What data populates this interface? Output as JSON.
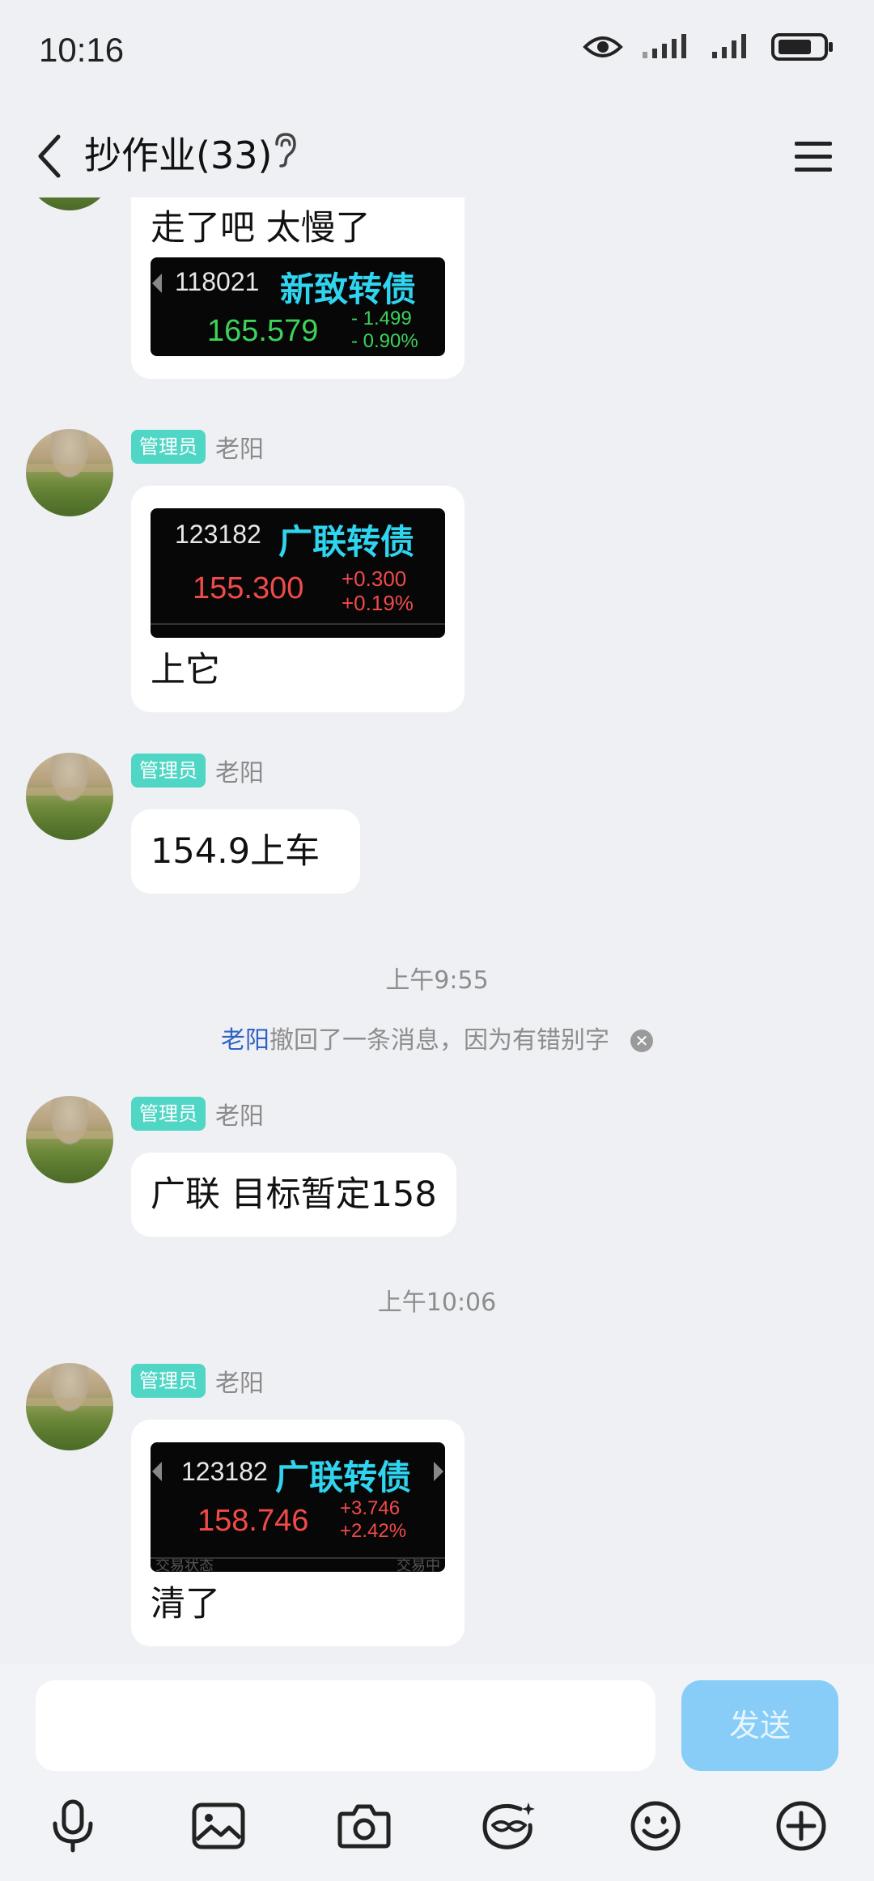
{
  "status_bar": {
    "time": "10:16"
  },
  "header": {
    "title": "抄作业(33)"
  },
  "messages": [
    {
      "text_top": "走了吧 太慢了",
      "card": {
        "code": "118021",
        "name": "新致转债",
        "price": "165.579",
        "change1": "- 1.499",
        "change2": "- 0.90%",
        "color": "#3dd25a"
      }
    },
    {
      "badge": "管理员",
      "sender": "老阳",
      "card": {
        "code": "123182",
        "name": "广联转债",
        "price": "155.300",
        "change1": "+0.300",
        "change2": "+0.19%",
        "color": "#f14a4a"
      },
      "text_bottom": "上它"
    },
    {
      "badge": "管理员",
      "sender": "老阳",
      "text": "154.9上车"
    },
    {
      "badge": "管理员",
      "sender": "老阳",
      "text": "广联 目标暂定158"
    },
    {
      "badge": "管理员",
      "sender": "老阳",
      "card": {
        "code": "123182",
        "name": "广联转债",
        "price": "158.746",
        "change1": "+3.746",
        "change2": "+2.42%",
        "color": "#f14a4a",
        "footer_left": "交易状态",
        "footer_right": "交易中"
      },
      "text_bottom": "清了"
    }
  ],
  "separators": {
    "t1": "上午9:55",
    "t2": "上午10:06"
  },
  "system": {
    "name": "老阳",
    "text": "撤回了一条消息，因为有错别字"
  },
  "input": {
    "value": "",
    "send_label": "发送"
  },
  "toolbar_icons": [
    "mic-icon",
    "image-icon",
    "camera-icon",
    "sticker-icon",
    "emoji-icon",
    "plus-icon"
  ]
}
